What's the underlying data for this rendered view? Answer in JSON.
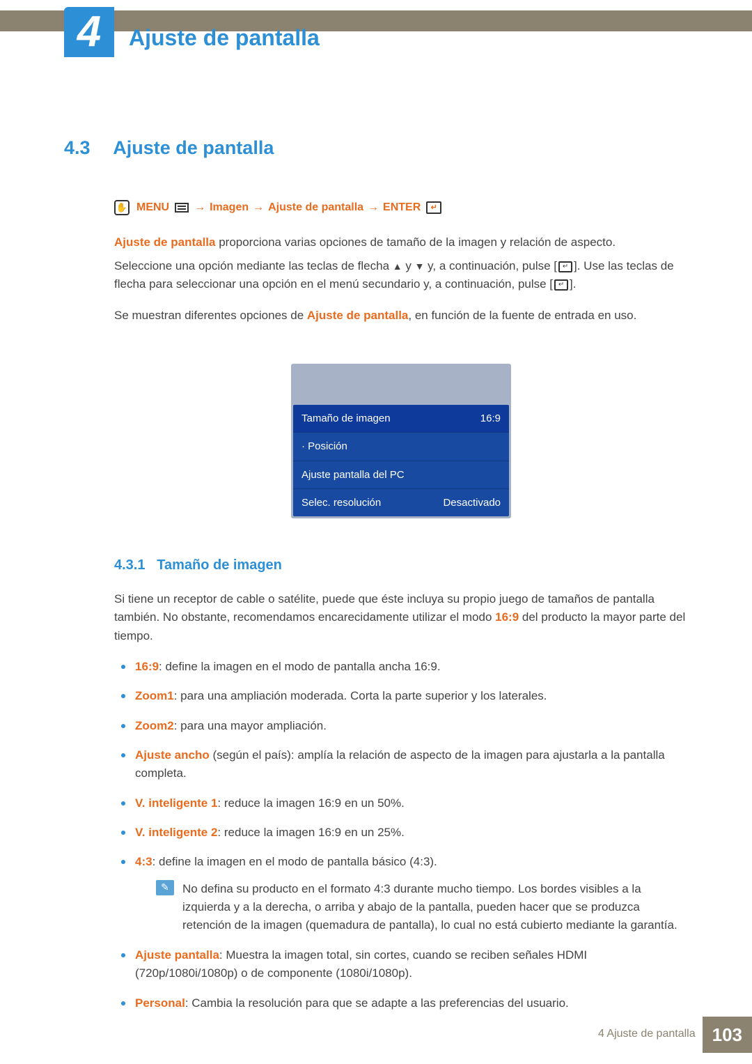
{
  "chapter": {
    "number": "4",
    "title": "Ajuste de pantalla"
  },
  "section": {
    "number": "4.3",
    "title": "Ajuste de pantalla"
  },
  "breadcrumb": {
    "menu": "MENU",
    "item1": "Imagen",
    "item2": "Ajuste de pantalla",
    "enter": "ENTER",
    "arrow": "→"
  },
  "intro": {
    "p1_hl": "Ajuste de pantalla",
    "p1_rest": " proporciona varias opciones de tamaño de la imagen y relación de aspecto.",
    "p2_a": "Seleccione una opción mediante las teclas de flecha ",
    "p2_mid": " y ",
    "p2_b": " y, a continuación, pulse [",
    "p2_c": "]. Use las teclas de flecha para seleccionar una opción en el menú secundario y, a continuación, pulse [",
    "p2_d": "].",
    "p3_a": "Se muestran diferentes opciones de ",
    "p3_hl": "Ajuste de pantalla",
    "p3_b": ", en función de la fuente de entrada en uso."
  },
  "osd": {
    "rows": [
      {
        "label": "Tamaño de imagen",
        "value": "16:9"
      },
      {
        "label": "· Posición",
        "value": ""
      },
      {
        "label": "Ajuste pantalla del PC",
        "value": ""
      },
      {
        "label": "Selec. resolución",
        "value": "Desactivado"
      }
    ]
  },
  "subsection": {
    "number": "4.3.1",
    "title": "Tamaño de imagen",
    "intro_a": "Si tiene un receptor de cable o satélite, puede que éste incluya su propio juego de tamaños de pantalla también. No obstante, recomendamos encarecidamente utilizar el modo ",
    "intro_hl": "16:9",
    "intro_b": " del producto la mayor parte del tiempo.",
    "options": [
      {
        "label": "16:9",
        "text": ": define la imagen en el modo de pantalla ancha 16:9."
      },
      {
        "label": "Zoom1",
        "text": ": para una ampliación moderada. Corta la parte superior y los laterales."
      },
      {
        "label": "Zoom2",
        "text": ": para una mayor ampliación."
      },
      {
        "label": "Ajuste ancho",
        "text": " (según el país): amplía la relación de aspecto de la imagen para ajustarla a la pantalla completa."
      },
      {
        "label": "V. inteligente 1",
        "text": ": reduce la imagen 16:9 en un 50%."
      },
      {
        "label": "V. inteligente 2",
        "text": ": reduce la imagen 16:9 en un 25%."
      },
      {
        "label": "4:3",
        "text": ": define la imagen en el modo de pantalla básico (4:3)."
      }
    ],
    "note": "No defina su producto en el formato 4:3 durante mucho tiempo. Los bordes visibles a la izquierda y a la derecha, o arriba y abajo de la pantalla, pueden hacer que se produzca retención de la imagen (quemadura de pantalla), lo cual no está cubierto mediante la garantía.",
    "options_after": [
      {
        "label": "Ajuste pantalla",
        "text": ": Muestra la imagen total, sin cortes, cuando se reciben señales HDMI (720p/1080i/1080p) o de componente (1080i/1080p)."
      },
      {
        "label": "Personal",
        "text": ": Cambia la resolución para que se adapte a las preferencias del usuario."
      }
    ]
  },
  "footer": {
    "label": "4 Ajuste de pantalla",
    "page": "103"
  }
}
